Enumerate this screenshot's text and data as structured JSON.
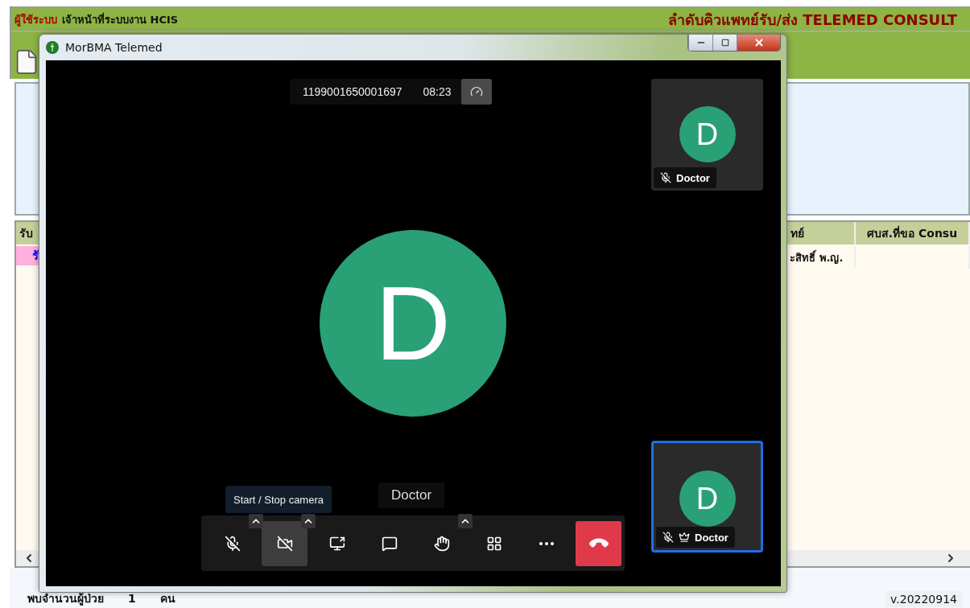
{
  "header": {
    "user_label": "ผู้ใช้ระบบ",
    "user_name": "เจ้าหน้าที่ระบบงาน HCIS",
    "title": "ลำดับคิวแพทย์รับ/ส่ง TELEMED CONSULT"
  },
  "table": {
    "columns": [
      "รับ",
      "ทย์",
      "ศบส.ที่ขอ Consu"
    ],
    "rows": [
      {
        "column_1": "รั",
        "column_2": "ะสิทธิ์ พ.ญ."
      }
    ]
  },
  "footer": {
    "patient_count_label": "พบจำนวนผู้ป่วย",
    "patient_count": "1",
    "unit": "คน",
    "version": "v.20220914"
  },
  "call_window": {
    "title": "MorBMA Telemed",
    "meeting_id": "1199001650001697",
    "timer": "08:23",
    "main_participant": {
      "initial": "D"
    },
    "thumbnails": [
      {
        "initial": "D",
        "name": "Doctor",
        "muted": true,
        "moderator": false,
        "selected": false
      },
      {
        "initial": "D",
        "name": "Doctor",
        "muted": true,
        "moderator": true,
        "selected": true
      }
    ],
    "speaker_name": "Doctor",
    "tooltip": "Start / Stop camera",
    "toolbar": [
      {
        "kind": "mic",
        "off": true,
        "has_menu": true,
        "active": false
      },
      {
        "kind": "camera",
        "off": true,
        "has_menu": true,
        "active": true
      },
      {
        "kind": "share",
        "has_menu": false,
        "active": false
      },
      {
        "kind": "chat",
        "has_menu": false,
        "active": false
      },
      {
        "kind": "hand",
        "has_menu": true,
        "active": false
      },
      {
        "kind": "tiles",
        "has_menu": false,
        "active": false
      },
      {
        "kind": "more",
        "has_menu": false,
        "active": false
      },
      {
        "kind": "hangup",
        "has_menu": false,
        "active": false
      }
    ]
  }
}
